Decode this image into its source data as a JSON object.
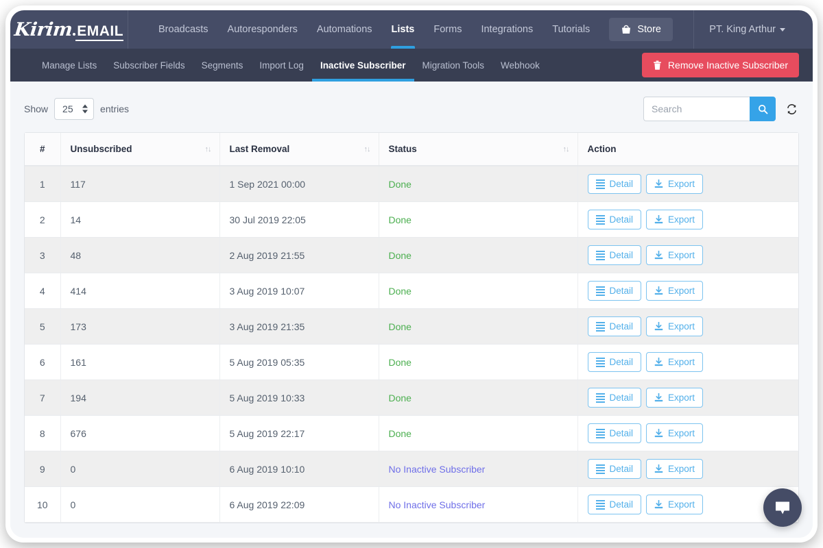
{
  "brand": {
    "name_script": "Kirim",
    "name_block": "EMAIL"
  },
  "topnav": {
    "items": [
      {
        "label": "Broadcasts",
        "active": false
      },
      {
        "label": "Autoresponders",
        "active": false
      },
      {
        "label": "Automations",
        "active": false
      },
      {
        "label": "Lists",
        "active": true
      },
      {
        "label": "Forms",
        "active": false
      },
      {
        "label": "Integrations",
        "active": false
      },
      {
        "label": "Tutorials",
        "active": false
      }
    ],
    "store_label": "Store",
    "store_icon": "shopping-bag-icon",
    "account_label": "PT. King Arthur"
  },
  "subnav": {
    "items": [
      {
        "label": "Manage Lists",
        "active": false
      },
      {
        "label": "Subscriber Fields",
        "active": false
      },
      {
        "label": "Segments",
        "active": false
      },
      {
        "label": "Import Log",
        "active": false
      },
      {
        "label": "Inactive Subscriber",
        "active": true
      },
      {
        "label": "Migration Tools",
        "active": false
      },
      {
        "label": "Webhook",
        "active": false
      }
    ],
    "remove_button_label": "Remove Inactive Subscriber",
    "remove_button_icon": "trash-icon",
    "remove_button_color": "#e74c5e"
  },
  "controls": {
    "show_label": "Show",
    "entries_value": "25",
    "entries_label": "entries",
    "search_placeholder": "Search",
    "search_value": "",
    "search_icon": "search-icon",
    "refresh_icon": "refresh-icon",
    "search_button_color": "#35a3e8"
  },
  "table": {
    "columns": [
      {
        "label": "#",
        "sortable": false
      },
      {
        "label": "Unsubscribed",
        "sortable": true
      },
      {
        "label": "Last Removal",
        "sortable": true
      },
      {
        "label": "Status",
        "sortable": true
      },
      {
        "label": "Action",
        "sortable": false
      }
    ],
    "sort_glyph": "↑↓",
    "action_labels": {
      "detail": "Detail",
      "export": "Export"
    },
    "action_icons": {
      "detail": "list-icon",
      "export": "download-icon"
    },
    "status_colors": {
      "done": "#4caf50",
      "none": "#6f6fe8"
    },
    "rows": [
      {
        "index": "1",
        "unsubscribed": "117",
        "last_removal": "1 Sep 2021 00:00",
        "status": "Done",
        "status_type": "done"
      },
      {
        "index": "2",
        "unsubscribed": "14",
        "last_removal": "30 Jul 2019 22:05",
        "status": "Done",
        "status_type": "done"
      },
      {
        "index": "3",
        "unsubscribed": "48",
        "last_removal": "2 Aug 2019 21:55",
        "status": "Done",
        "status_type": "done"
      },
      {
        "index": "4",
        "unsubscribed": "414",
        "last_removal": "3 Aug 2019 10:07",
        "status": "Done",
        "status_type": "done"
      },
      {
        "index": "5",
        "unsubscribed": "173",
        "last_removal": "3 Aug 2019 21:35",
        "status": "Done",
        "status_type": "done"
      },
      {
        "index": "6",
        "unsubscribed": "161",
        "last_removal": "5 Aug 2019 05:35",
        "status": "Done",
        "status_type": "done"
      },
      {
        "index": "7",
        "unsubscribed": "194",
        "last_removal": "5 Aug 2019 10:33",
        "status": "Done",
        "status_type": "done"
      },
      {
        "index": "8",
        "unsubscribed": "676",
        "last_removal": "5 Aug 2019 22:17",
        "status": "Done",
        "status_type": "done"
      },
      {
        "index": "9",
        "unsubscribed": "0",
        "last_removal": "6 Aug 2019 10:10",
        "status": "No Inactive Subscriber",
        "status_type": "none"
      },
      {
        "index": "10",
        "unsubscribed": "0",
        "last_removal": "6 Aug 2019 22:09",
        "status": "No Inactive Subscriber",
        "status_type": "none"
      }
    ]
  },
  "chat": {
    "icon": "chat-bubble-icon",
    "color": "#454c66"
  }
}
